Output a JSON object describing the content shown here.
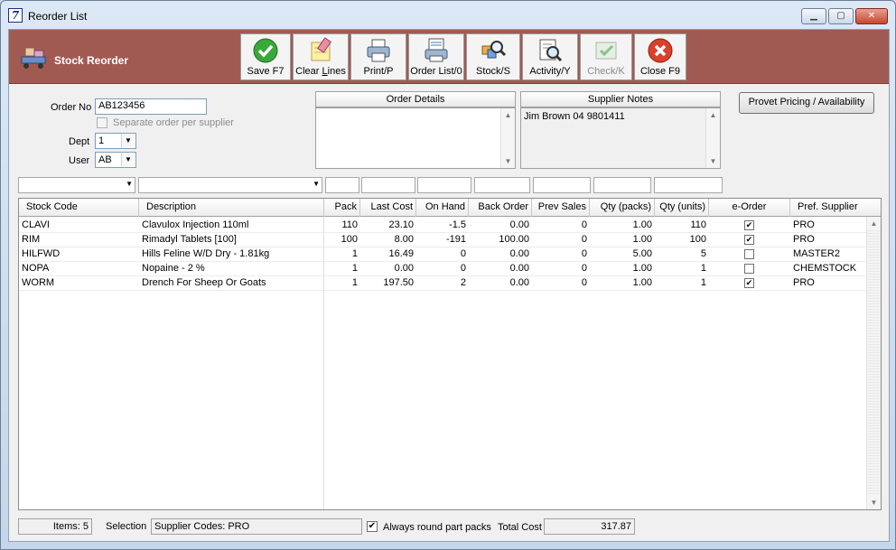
{
  "window": {
    "title": "Reorder List",
    "icon_glyph": "7",
    "controls": {
      "minimize": "▁",
      "maximize": "▢",
      "close": "✕"
    }
  },
  "band": {
    "title": "Stock Reorder"
  },
  "toolbar": {
    "save": "Save F7",
    "clear_pre": "Clear ",
    "clear_u": "L",
    "clear_post": "ines",
    "print": "Print/P",
    "order_list": "Order List/0",
    "stock": "Stock/S",
    "activity": "Activity/Y",
    "check": "Check/K",
    "close": "Close F9"
  },
  "form": {
    "order_no_label": "Order No",
    "order_no_value": "AB123456",
    "separate_label": "Separate order per supplier",
    "dept_label": "Dept",
    "dept_value": "1",
    "user_label": "User",
    "user_value": "AB"
  },
  "order_details": {
    "header": "Order Details",
    "text": ""
  },
  "supplier_notes": {
    "header": "Supplier Notes",
    "text": "Jim Brown 04 9801411"
  },
  "provet_button": "Provet Pricing / Availability",
  "grid": {
    "columns": [
      "Stock Code",
      "Description",
      "Pack",
      "Last Cost",
      "On Hand",
      "Back Order",
      "Prev Sales",
      "Qty (packs)",
      "Qty (units)",
      "e-Order",
      "Pref. Supplier"
    ],
    "rows": [
      {
        "code": "CLAVI",
        "desc": "Clavulox Injection 110ml",
        "pack": "110",
        "last_cost": "23.10",
        "on_hand": "-1.5",
        "back_order": "0.00",
        "prev_sales": "0",
        "qty_packs": "1.00",
        "qty_units": "110",
        "eorder": "✔",
        "supplier": "PRO"
      },
      {
        "code": "RIM",
        "desc": "Rimadyl Tablets [100]",
        "pack": "100",
        "last_cost": "8.00",
        "on_hand": "-191",
        "back_order": "100.00",
        "prev_sales": "0",
        "qty_packs": "1.00",
        "qty_units": "100",
        "eorder": "✔",
        "supplier": "PRO"
      },
      {
        "code": "HILFWD",
        "desc": "Hills Feline W/D Dry - 1.81kg",
        "pack": "1",
        "last_cost": "16.49",
        "on_hand": "0",
        "back_order": "0.00",
        "prev_sales": "0",
        "qty_packs": "5.00",
        "qty_units": "5",
        "eorder": "",
        "supplier": "MASTER2"
      },
      {
        "code": "NOPA",
        "desc": "Nopaine - 2 %",
        "pack": "1",
        "last_cost": "0.00",
        "on_hand": "0",
        "back_order": "0.00",
        "prev_sales": "0",
        "qty_packs": "1.00",
        "qty_units": "1",
        "eorder": "",
        "supplier": "CHEMSTOCK"
      },
      {
        "code": "WORM",
        "desc": "Drench For Sheep Or Goats",
        "pack": "1",
        "last_cost": "197.50",
        "on_hand": "2",
        "back_order": "0.00",
        "prev_sales": "0",
        "qty_packs": "1.00",
        "qty_units": "1",
        "eorder": "✔",
        "supplier": "PRO"
      }
    ]
  },
  "status": {
    "items": "Items: 5",
    "selection_label": "Selection",
    "selection_value": "Supplier Codes: PRO",
    "round_check": "✔",
    "round_label": "Always round part packs",
    "total_label": "Total Cost",
    "total_value": "317.87"
  }
}
